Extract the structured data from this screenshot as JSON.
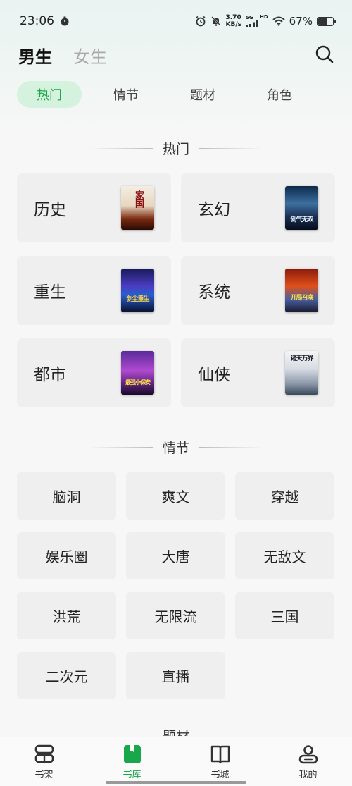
{
  "status_bar": {
    "time": "23:06",
    "net_speed_value": "3.70",
    "net_speed_unit": "KB/s",
    "net_type_top": "5G",
    "net_type_bottom": "HD",
    "battery": "67%",
    "battery_level": 0.67
  },
  "header": {
    "tabs": [
      {
        "label": "男生",
        "active": true
      },
      {
        "label": "女生",
        "active": false
      }
    ]
  },
  "sub_tabs": [
    {
      "label": "热门",
      "active": true
    },
    {
      "label": "情节",
      "active": false
    },
    {
      "label": "题材",
      "active": false
    },
    {
      "label": "角色",
      "active": false
    }
  ],
  "hot_section": {
    "title": "热门",
    "genres": [
      {
        "label": "历史",
        "cover_title": "家国"
      },
      {
        "label": "玄幻",
        "cover_title": "剑气无双"
      },
      {
        "label": "重生",
        "cover_title": "剑尘重生"
      },
      {
        "label": "系统",
        "cover_title": "开局召唤"
      },
      {
        "label": "都市",
        "cover_title": "最强小保安"
      },
      {
        "label": "仙侠",
        "cover_title": "诸天万界"
      }
    ]
  },
  "plot_section": {
    "title": "情节",
    "items": [
      "脑洞",
      "爽文",
      "穿越",
      "娱乐圈",
      "大唐",
      "无敌文",
      "洪荒",
      "无限流",
      "三国",
      "二次元",
      "直播"
    ]
  },
  "next_section_title": "题材",
  "bottom_nav": {
    "items": [
      {
        "label": "书架",
        "icon": "bookshelf-icon",
        "active": false
      },
      {
        "label": "书库",
        "icon": "library-icon",
        "active": true
      },
      {
        "label": "书城",
        "icon": "book-store-icon",
        "active": false
      },
      {
        "label": "我的",
        "icon": "profile-icon",
        "active": false
      }
    ]
  },
  "colors": {
    "accent": "#1aa64a",
    "active_tab_bg": "#d4f2dd",
    "card_bg": "#efefef"
  }
}
